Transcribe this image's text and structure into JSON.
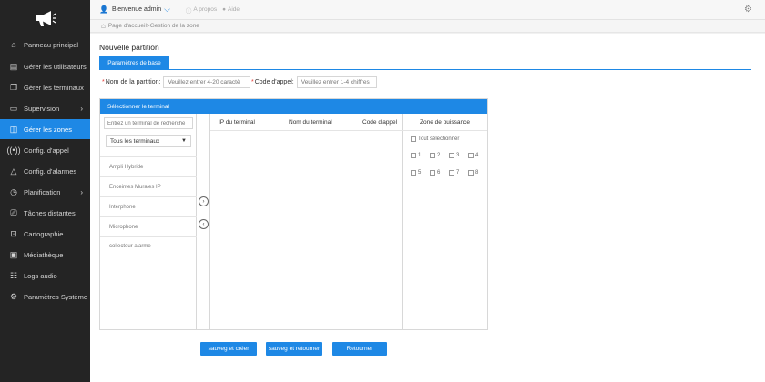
{
  "sidebar": {
    "logo_icon": "megaphone-icon",
    "items": [
      {
        "label": "Panneau principal",
        "icon": "home-icon"
      },
      {
        "label": "Gérer les utilisateurs",
        "icon": "user-card-icon"
      },
      {
        "label": "Gérer les terminaux",
        "icon": "terminal-icon"
      },
      {
        "label": "Supervision",
        "icon": "monitor-icon"
      },
      {
        "label": "Gérer les zones",
        "icon": "zone-icon"
      },
      {
        "label": "Config. d'appel",
        "icon": "broadcast-icon"
      },
      {
        "label": "Config. d'alarmes",
        "icon": "alarm-icon"
      },
      {
        "label": "Planification",
        "icon": "clock-icon"
      },
      {
        "label": "Tâches distantes",
        "icon": "remote-icon"
      },
      {
        "label": "Cartographie",
        "icon": "map-icon"
      },
      {
        "label": "Médiathèque",
        "icon": "media-icon"
      },
      {
        "label": "Logs audio",
        "icon": "log-icon"
      },
      {
        "label": "Paramètres Système",
        "icon": "settings-icon"
      }
    ],
    "active_color": "#1e88e5"
  },
  "topbar": {
    "welcome": "Bienvenue",
    "username": "admin",
    "about": "A propos",
    "help": "Aide"
  },
  "breadcrumb": {
    "text": "Page d'accueil>Gestion de la zone"
  },
  "page": {
    "title": "Nouvelle partition",
    "tab_label": "Paramètres de base"
  },
  "form": {
    "name_label": "Nom de la partition:",
    "name_placeholder": "Veuillez entrer 4-20 caractè",
    "code_label": "Code d'appel:",
    "code_placeholder": "Veuillez entrer 1-4 chiffres"
  },
  "terminal_panel": {
    "header": "Sélectionner le terminal",
    "search_placeholder": "Entrez un terminal de recherche",
    "filter_selected": "Tous les terminaux",
    "terminal_types": [
      "Ampli Hybride",
      "Enceintes Murales IP",
      "Interphone",
      "Microphone",
      "collecteur alarme"
    ],
    "columns": [
      "IP du terminal",
      "Nom du terminal",
      "Code d'appel",
      "Zone de puissance"
    ],
    "select_all": "Tout sélectionner",
    "power_zones": [
      "1",
      "2",
      "3",
      "4",
      "5",
      "6",
      "7",
      "8"
    ]
  },
  "buttons": {
    "save_create": "sauveg et créer",
    "save_return": "sauveg et retourner",
    "back": "Retourner"
  }
}
